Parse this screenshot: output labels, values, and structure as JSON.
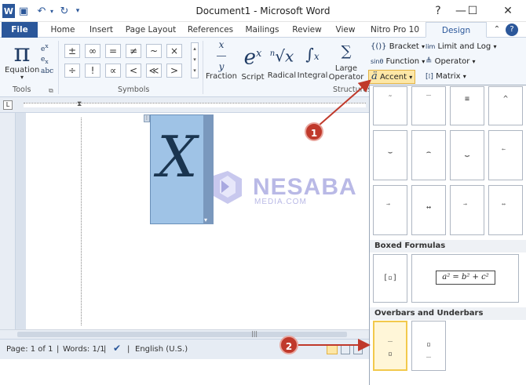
{
  "titlebar": {
    "title": "Document1 - Microsoft Word",
    "minimize": "—",
    "maximize": "☐",
    "close": "✕"
  },
  "tabs": [
    "File",
    "Home",
    "Insert",
    "Page Layout",
    "References",
    "Mailings",
    "Review",
    "View",
    "Nitro Pro 10",
    "Design"
  ],
  "ribbon": {
    "tools": {
      "equation": "Equation",
      "group": "Tools"
    },
    "symbols": {
      "group": "Symbols",
      "items": [
        "±",
        "∞",
        "=",
        "≠",
        "~",
        "×",
        "÷",
        "!",
        "∝",
        "<",
        "≪",
        ">"
      ]
    },
    "structures": {
      "group": "Structures",
      "fraction": "Fraction",
      "script": "Script",
      "radical": "Radical",
      "integral": "Integral",
      "large_operator": "Large Operator",
      "bracket": "Bracket",
      "function": "Function",
      "accent": "Accent",
      "limit_and_log": "Limit and Log",
      "operator": "Operator",
      "matrix": "Matrix"
    }
  },
  "document": {
    "equation_text": "X"
  },
  "watermark": {
    "name": "NESABA",
    "sub": "MEDIA.COM"
  },
  "gallery": {
    "section_boxed": "Boxed Formulas",
    "boxed_formula": "a² = b² + c²",
    "section_overbars": "Overbars and Underbars"
  },
  "status": {
    "page": "Page: 1 of 1",
    "words": "Words: 1/1",
    "language": "English (U.S.)"
  },
  "annotations": {
    "step1": "1",
    "step2": "2"
  },
  "colors": {
    "accent": "#2b579a",
    "callout": "#c0392b"
  }
}
